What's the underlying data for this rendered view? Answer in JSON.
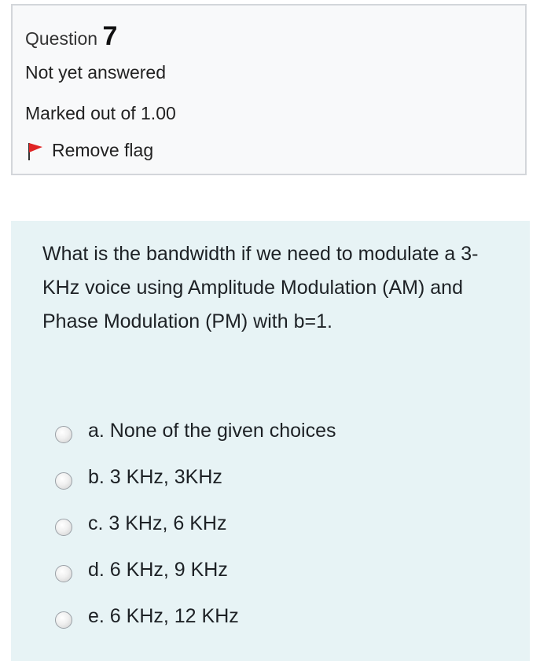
{
  "info": {
    "question_label": "Question",
    "question_number": "7",
    "state": "Not yet answered",
    "grade": "Marked out of 1.00",
    "flag_label": "Remove flag",
    "flag_color": "#e02424"
  },
  "question": {
    "text": "What is the bandwidth if we need to modulate a 3-KHz voice using Amplitude Modulation (AM) and Phase Modulation (PM) with b=1.",
    "answers": [
      {
        "label": "a. None of the given choices",
        "selected": false
      },
      {
        "label": "b. 3 KHz, 3KHz",
        "selected": false
      },
      {
        "label": "c. 3 KHz, 6 KHz",
        "selected": false
      },
      {
        "label": "d. 6 KHz, 9 KHz",
        "selected": false
      },
      {
        "label": "e. 6 KHz, 12 KHz",
        "selected": false
      }
    ]
  },
  "colors": {
    "info_background": "#f8f9fa",
    "content_background": "#e7f3f5"
  }
}
